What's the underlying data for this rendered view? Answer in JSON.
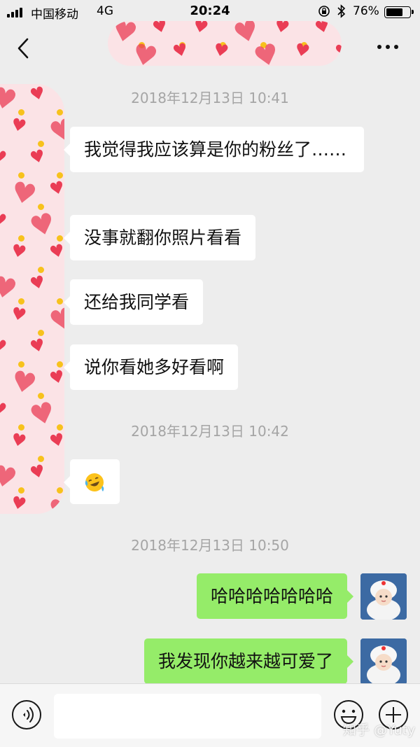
{
  "status_bar": {
    "carrier": "中国移动",
    "network": "4G",
    "time": "20:24",
    "battery_percent": "76%",
    "battery_level": 0.76
  },
  "nav": {
    "back_icon": "chevron-left-icon",
    "more_icon": "ellipsis-icon"
  },
  "messages": [
    {
      "type": "timestamp",
      "text": "2018年12月13日 10:41"
    },
    {
      "type": "incoming",
      "text": "我觉得我应该算是你的粉丝了……"
    },
    {
      "type": "incoming",
      "text": "没事就翻你照片看看"
    },
    {
      "type": "incoming",
      "text": "还给我同学看"
    },
    {
      "type": "incoming",
      "text": "说你看她多好看啊"
    },
    {
      "type": "timestamp",
      "text": "2018年12月13日 10:42"
    },
    {
      "type": "incoming",
      "emoji": "laughing-crying-emoji"
    },
    {
      "type": "timestamp",
      "text": "2018年12月13日 10:50"
    },
    {
      "type": "outgoing",
      "text": "哈哈哈哈哈哈哈"
    },
    {
      "type": "outgoing",
      "text": "我发现你越来越可爱了"
    }
  ],
  "input_bar": {
    "voice_icon": "voice-icon",
    "input_value": "",
    "emoji_icon": "emoji-icon",
    "plus_icon": "plus-icon"
  },
  "watermark": "知乎 @Yuty",
  "colors": {
    "background": "#ededed",
    "incoming_bubble": "#ffffff",
    "outgoing_bubble": "#95ec69",
    "timestamp": "#a5a5a5",
    "mask": "#fbe3e6",
    "heart": "#ea3d55"
  }
}
